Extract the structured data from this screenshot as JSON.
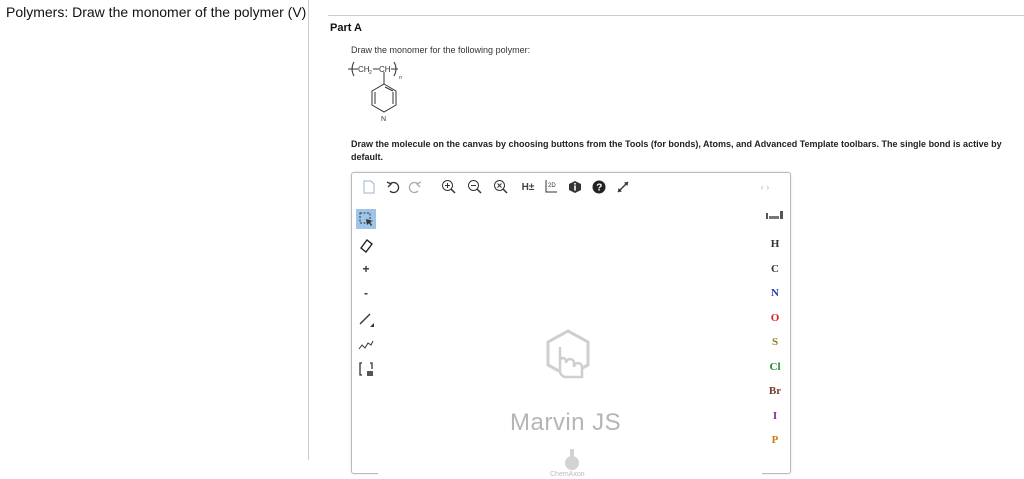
{
  "sidebar": {
    "title": "Polymers: Draw the monomer of the polymer (V)"
  },
  "part": {
    "title": "Part A",
    "prompt": "Draw the monomer for the following polymer:",
    "instructions": "Draw the molecule on the canvas by choosing buttons from the Tools (for bonds), Atoms, and Advanced Template toolbars. The single bond is active by default."
  },
  "polymer": {
    "chain_left": "CH",
    "sub2": "2",
    "chain_right": "CH",
    "n": "n",
    "ring_atom": "N"
  },
  "editor": {
    "top_toolbar": [
      {
        "icon": "new-document-icon"
      },
      {
        "icon": "undo-icon"
      },
      {
        "icon": "redo-icon"
      },
      {
        "icon": "zoom-in-icon"
      },
      {
        "icon": "zoom-out-icon"
      },
      {
        "icon": "zoom-reset-icon"
      },
      {
        "icon": "hydrogen-toggle-icon",
        "label": "H±"
      },
      {
        "icon": "2d-clean-icon",
        "label": "2D"
      },
      {
        "icon": "info-icon"
      },
      {
        "icon": "help-icon"
      },
      {
        "icon": "fullscreen-icon"
      },
      {
        "icon": "atom-panel-expand-icon"
      }
    ],
    "left_toolbar": [
      {
        "icon": "select-icon"
      },
      {
        "icon": "eraser-icon"
      },
      {
        "icon": "plus-charge-icon",
        "label": "+"
      },
      {
        "icon": "minus-charge-icon",
        "label": "-"
      },
      {
        "icon": "single-bond-icon"
      },
      {
        "icon": "chain-icon"
      },
      {
        "icon": "bracket-icon"
      }
    ],
    "atoms": [
      {
        "symbol": "H",
        "color": "#333333"
      },
      {
        "symbol": "C",
        "color": "#333333"
      },
      {
        "symbol": "N",
        "color": "#2a3bb0"
      },
      {
        "symbol": "O",
        "color": "#e0211f"
      },
      {
        "symbol": "S",
        "color": "#8b7d1a"
      },
      {
        "symbol": "Cl",
        "color": "#1f8c1f"
      },
      {
        "symbol": "Br",
        "color": "#7a3a2a"
      },
      {
        "symbol": "I",
        "color": "#7b2ba0"
      },
      {
        "symbol": "P",
        "color": "#d07a10"
      }
    ],
    "logo_text": "Marvin JS",
    "vendor": "ChemAxon"
  }
}
